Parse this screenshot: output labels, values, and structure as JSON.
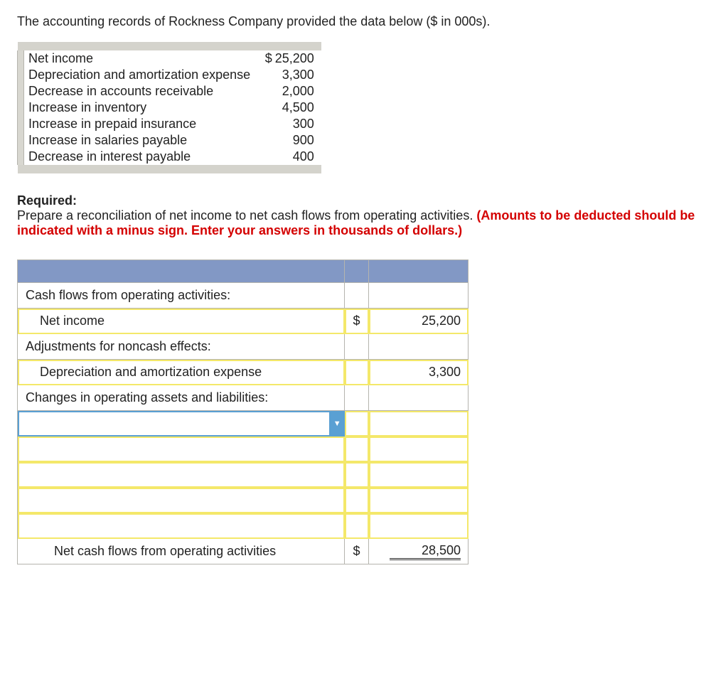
{
  "intro": "The accounting records of Rockness Company provided the data below ($ in 000s).",
  "data_rows": [
    {
      "label": "Net income",
      "currency": "$",
      "value": "25,200"
    },
    {
      "label": "Depreciation and amortization expense",
      "currency": "",
      "value": "3,300"
    },
    {
      "label": "Decrease in accounts receivable",
      "currency": "",
      "value": "2,000"
    },
    {
      "label": "Increase in inventory",
      "currency": "",
      "value": "4,500"
    },
    {
      "label": "Increase in prepaid insurance",
      "currency": "",
      "value": "300"
    },
    {
      "label": "Increase in salaries payable",
      "currency": "",
      "value": "900"
    },
    {
      "label": "Decrease in interest payable",
      "currency": "",
      "value": "400"
    }
  ],
  "required_label": "Required:",
  "required_text": "Prepare a reconciliation of net income to net cash flows from operating activities. ",
  "required_red": "(Amounts to be deducted should be indicated with a minus sign. Enter your answers in thousands of dollars.)",
  "answer": {
    "row_cash_flows": "Cash flows from operating activities:",
    "row_net_income": "Net income",
    "net_income_currency": "$",
    "net_income_value": "25,200",
    "row_adjustments": "Adjustments for noncash effects:",
    "row_dep_amort": "Depreciation and amortization expense",
    "dep_amort_value": "3,300",
    "row_changes": "Changes in operating assets and liabilities:",
    "row_net_cash": "Net cash flows from operating activities",
    "net_cash_currency": "$",
    "net_cash_value": "28,500"
  }
}
